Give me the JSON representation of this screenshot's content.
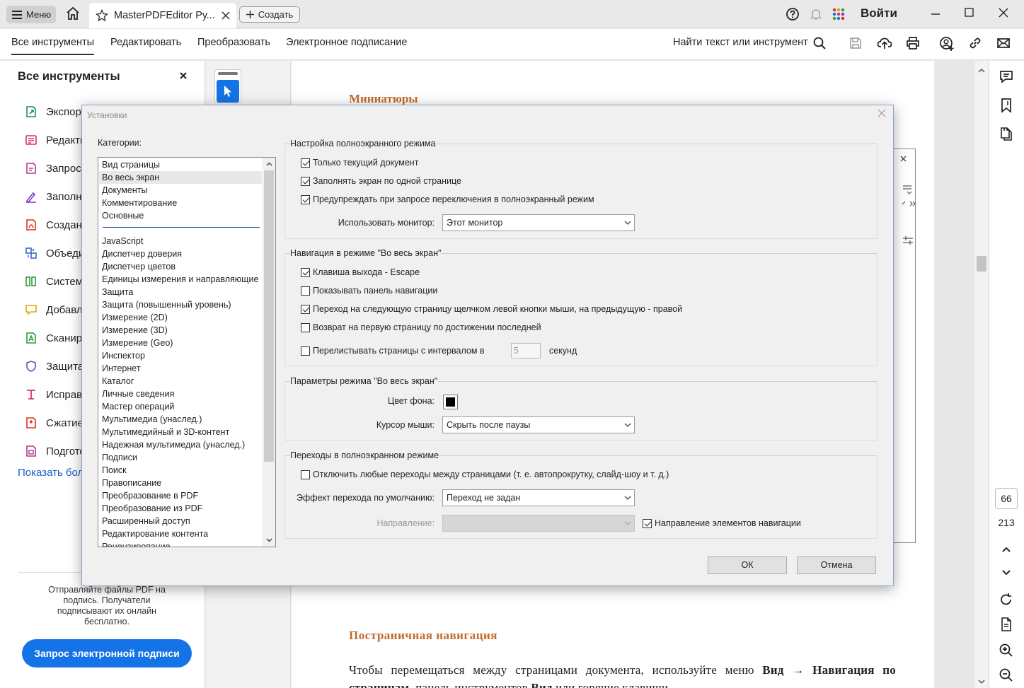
{
  "app": {
    "menu_label": "Меню",
    "tab_title": "MasterPDFEditor Ру...",
    "create_label": "Создать",
    "signin_label": "Войти"
  },
  "toolbar": {
    "tabs": [
      "Все инструменты",
      "Редактировать",
      "Преобразовать",
      "Электронное подписание"
    ],
    "search_label": "Найти текст или инструмент"
  },
  "left_panel": {
    "title": "Все инструменты",
    "items": [
      {
        "label": "Экспорт",
        "icon": "export-pdf-icon",
        "color": "#1a8a7a"
      },
      {
        "label": "Редакти",
        "icon": "edit-pdf-icon",
        "color": "#d6336c"
      },
      {
        "label": "Запрос",
        "icon": "request-signature-icon",
        "color": "#b03a8f"
      },
      {
        "label": "Заполні",
        "icon": "fill-sign-icon",
        "color": "#7a3fc2"
      },
      {
        "label": "Создан",
        "icon": "create-pdf-icon",
        "color": "#d9341f"
      },
      {
        "label": "Объеди",
        "icon": "combine-files-icon",
        "color": "#3d63d1"
      },
      {
        "label": "Систем",
        "icon": "organize-pages-icon",
        "color": "#2f9a3a"
      },
      {
        "label": "Добавл",
        "icon": "add-comment-icon",
        "color": "#e0a400"
      },
      {
        "label": "Сканир",
        "icon": "scan-ocr-icon",
        "color": "#2f9a3a"
      },
      {
        "label": "Защита",
        "icon": "protect-icon",
        "color": "#6a4fc8"
      },
      {
        "label": "Исправ",
        "icon": "redact-icon",
        "color": "#d6336c"
      },
      {
        "label": "Сжатие",
        "icon": "compress-icon",
        "color": "#d9341f"
      },
      {
        "label": "Подгото",
        "icon": "prepare-form-icon",
        "color": "#b03a8f"
      }
    ],
    "show_more": "Показать бол",
    "promo_text": "Отправляйте файлы PDF на подпись. Получатели подписывают их онлайн бесплатно.",
    "promo_button": "Запрос электронной подписи"
  },
  "document": {
    "heading1": "Миниатюры",
    "heading2": "Постраничная навигация",
    "para_start": "Чтобы перемещаться между страницами документа, используйте меню ",
    "para_bold1": "Вид",
    "para_arrow": " → ",
    "para_bold2": "Навигация по страницам",
    "para_mid": ", панель инструментов ",
    "para_bold3": "Вид",
    "para_end": " или горячие клавиши."
  },
  "page_nav": {
    "current": "66",
    "total": "213"
  },
  "dialog": {
    "title": "Установки",
    "categories_label": "Категории:",
    "categories_top": [
      "Вид страницы",
      "Во весь экран",
      "Документы",
      "Комментирование",
      "Основные"
    ],
    "selected_category": "Во весь экран",
    "categories": [
      "JavaScript",
      "Диспетчер доверия",
      "Диспетчер цветов",
      "Единицы измерения и направляющие",
      "Защита",
      "Защита (повышенный уровень)",
      "Измерение (2D)",
      "Измерение (3D)",
      "Измерение (Geo)",
      "Инспектор",
      "Интернет",
      "Каталог",
      "Личные сведения",
      "Мастер операций",
      "Мультимедиа (унаслед.)",
      "Мультимедийный и 3D-контент",
      "Надежная мультимедиа (унаслед.)",
      "Подписи",
      "Поиск",
      "Правописание",
      "Преобразование в PDF",
      "Преобразование из PDF",
      "Расширенный доступ",
      "Редактирование контента",
      "Рецензирование"
    ],
    "group_fullscreen": {
      "title": "Настройка полноэкранного режима",
      "cb_current_doc": {
        "label": "Только текущий документ",
        "checked": true
      },
      "cb_one_page": {
        "label": "Заполнять экран по одной странице",
        "checked": true
      },
      "cb_warn": {
        "label": "Предупреждать при запросе переключения в полноэкранный режим",
        "checked": true
      },
      "monitor_label": "Использовать монитор:",
      "monitor_value": "Этот монитор"
    },
    "group_navigation": {
      "title": "Навигация в режиме \"Во весь экран\"",
      "cb_escape": {
        "label": "Клавиша выхода - Escape",
        "checked": true
      },
      "cb_navbar": {
        "label": "Показывать панель навигации",
        "checked": false
      },
      "cb_click": {
        "label": "Переход на следующую страницу щелчком левой кнопки мыши, на предыдущую - правой",
        "checked": true
      },
      "cb_loop": {
        "label": "Возврат на первую страницу по достижении последней",
        "checked": false
      },
      "cb_interval": {
        "label": "Перелистывать страницы с интервалом в",
        "checked": false
      },
      "interval_value": "5",
      "interval_unit": "секунд"
    },
    "group_params": {
      "title": "Параметры режима \"Во весь экран\"",
      "bg_color_label": "Цвет фона:",
      "bg_color": "#000000",
      "cursor_label": "Курсор мыши:",
      "cursor_value": "Скрыть после паузы"
    },
    "group_transitions": {
      "title": "Переходы в полноэкранном режиме",
      "cb_disable": {
        "label": "Отключить любые переходы между страницами (т. е. автопрокрутку, слайд-шоу и т. д.)",
        "checked": false
      },
      "effect_label": "Эффект перехода по умолчанию:",
      "effect_value": "Переход не задан",
      "direction_label": "Направление:",
      "cb_nav_direction": {
        "label": "Направление элементов навигации",
        "checked": true
      }
    },
    "ok_label": "ОК",
    "cancel_label": "Отмена"
  },
  "colors": {
    "accent": "#1473e6",
    "heading": "#c26a2a"
  }
}
